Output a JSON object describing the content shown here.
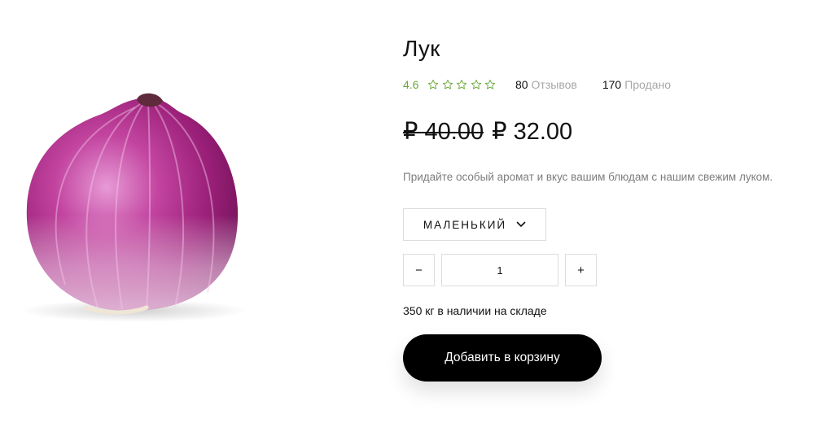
{
  "product": {
    "title": "Лук",
    "rating": "4.6",
    "stars_filled": 0,
    "stars_total": 5,
    "reviews_count": "80",
    "reviews_label": "Отзывов",
    "sold_count": "170",
    "sold_label": "Продано",
    "old_price": "₽ 40.00",
    "new_price": "₽ 32.00",
    "description": "Придайте особый аромат и вкус вашим блюдам с нашим свежим луком.",
    "size_option": "МАЛЕНЬКИЙ",
    "quantity": "1",
    "decrement_label": "−",
    "increment_label": "+",
    "stock_text": "350 кг в наличии на складе",
    "add_to_cart_label": "Добавить в корзину"
  },
  "icons": {
    "star": "star-outline-icon",
    "dropdown": "chevron-down-icon"
  },
  "colors": {
    "rating": "#6aa73a",
    "muted": "#a7a7a7",
    "button_bg": "#000000",
    "border": "#dcdcdc"
  }
}
